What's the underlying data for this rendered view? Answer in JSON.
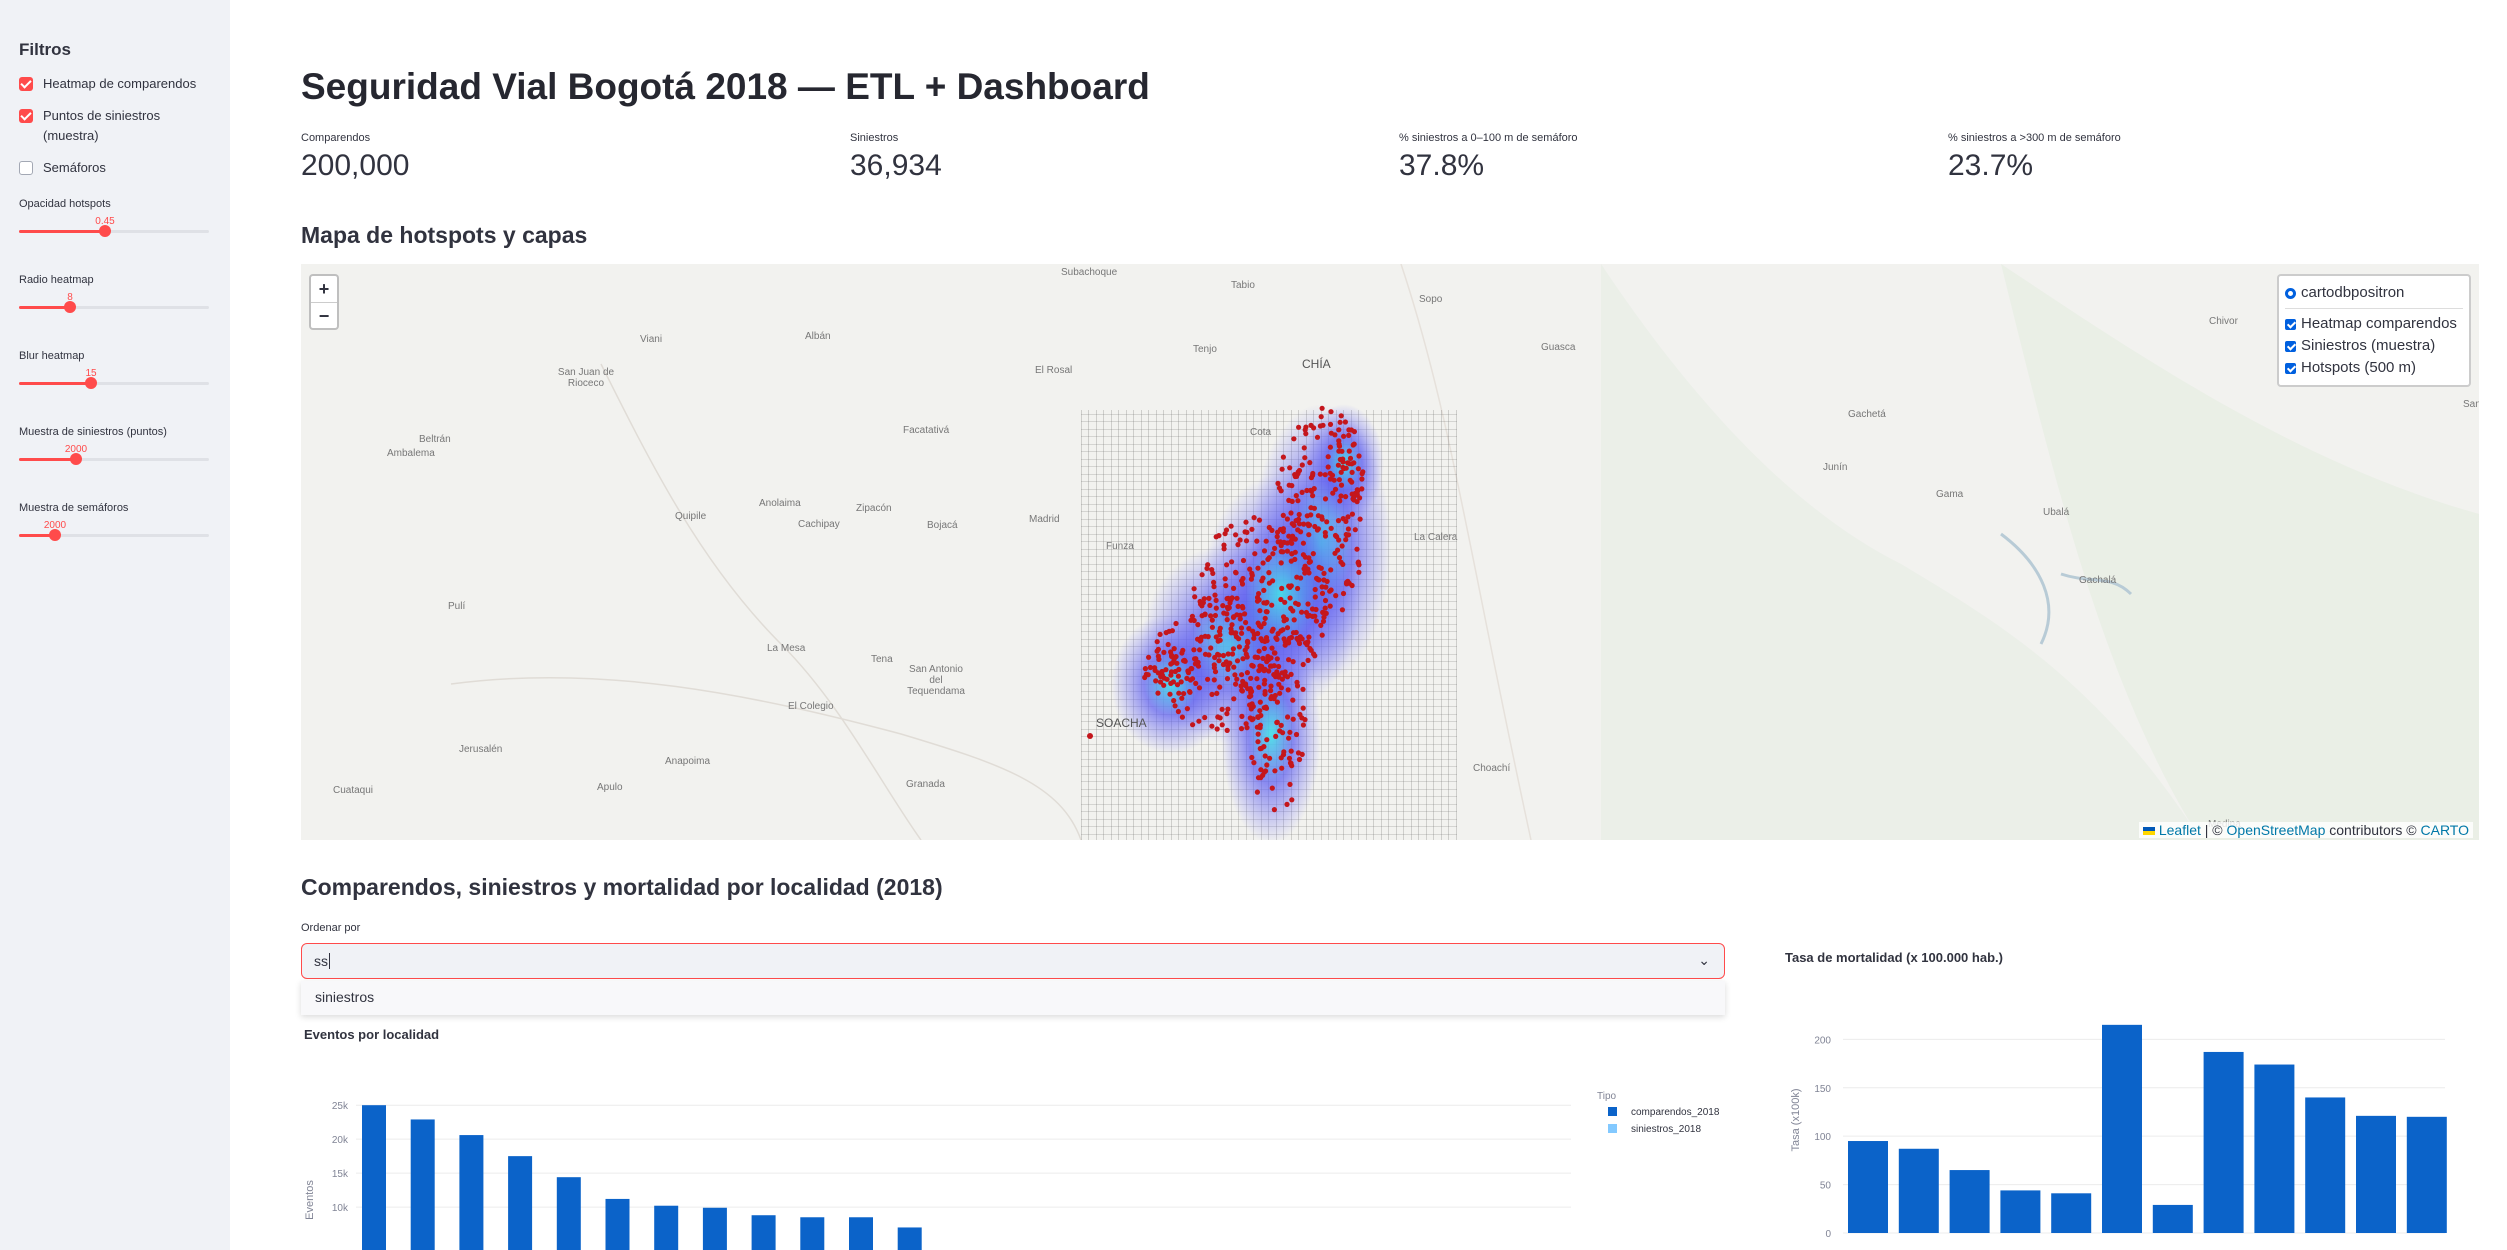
{
  "sidebar": {
    "title": "Filtros",
    "checkboxes": [
      {
        "label": "Heatmap de comparendos",
        "checked": true
      },
      {
        "label": "Puntos de siniestros (muestra)",
        "checked": true
      },
      {
        "label": "Semáforos",
        "checked": false
      }
    ],
    "sliders": [
      {
        "label": "Opacidad hotspots",
        "value": "0.45",
        "fraction": 0.45
      },
      {
        "label": "Radio heatmap",
        "value": "8",
        "fraction": 0.27
      },
      {
        "label": "Blur heatmap",
        "value": "15",
        "fraction": 0.38
      },
      {
        "label": "Muestra de siniestros (puntos)",
        "value": "2000",
        "fraction": 0.3
      },
      {
        "label": "Muestra de semáforos",
        "value": "2000",
        "fraction": 0.19
      }
    ]
  },
  "title": "Seguridad Vial Bogotá 2018 — ETL + Dashboard",
  "metrics": [
    {
      "label": "Comparendos",
      "value": "200,000"
    },
    {
      "label": "Siniestros",
      "value": "36,934"
    },
    {
      "label": "% siniestros a 0–100 m de semáforo",
      "value": "37.8%"
    },
    {
      "label": "% siniestros a >300 m de semáforo",
      "value": "23.7%"
    }
  ],
  "map_section": {
    "title": "Mapa de hotspots y capas",
    "zoom_in": "+",
    "zoom_out": "−",
    "base_layer": "cartodbpositron",
    "overlays": [
      "Heatmap comparendos",
      "Siniestros (muestra)",
      "Hotspots (500 m)"
    ],
    "attribution": {
      "leaflet": "Leaflet",
      "sep": "| ©",
      "osm": "OpenStreetMap",
      "contrib": "contributors ©",
      "carto": "CARTO"
    },
    "places": [
      "Subachoque",
      "Tabio",
      "Sopo",
      "Guasca",
      "Chivor",
      "Viani",
      "Albán",
      "Tenjo",
      "El Rosal",
      "CHÍA",
      "San Juan de Rioceco",
      "Beltrán",
      "Ambalema",
      "Facatativá",
      "Cachipay",
      "Anolaima",
      "Zipacón",
      "Bojacá",
      "Madrid",
      "Quipile",
      "Pulí",
      "La Mesa",
      "Tena",
      "San Antonio del Tequendama",
      "El Colegio",
      "Jerusalén",
      "Anapoima",
      "Apulo",
      "Granada",
      "Cuataqui",
      "SOACHA",
      "Choachí",
      "La Calera",
      "Funza",
      "Cota",
      "Gachetá",
      "Junín",
      "Gama",
      "Ubalá",
      "Gachalá",
      "Medina",
      "San"
    ]
  },
  "charts_section": {
    "title": "Comparendos, siniestros y mortalidad por localidad (2018)",
    "order_label": "Ordenar por",
    "order_input": "ss",
    "dropdown_option": "siniestros"
  },
  "chart_data": [
    {
      "type": "bar",
      "title": "Eventos por localidad",
      "ylabel": "Eventos",
      "legend_title": "Tipo",
      "yticks": [
        "10k",
        "15k",
        "20k",
        "25k"
      ],
      "series": [
        {
          "name": "comparendos_2018",
          "color": "#0b63c9",
          "values": [
            25000,
            22900,
            20600,
            17500,
            14400,
            11200,
            10200,
            9900,
            8800,
            8500,
            8500,
            7000
          ]
        },
        {
          "name": "siniestros_2018",
          "color": "#83c9ff",
          "values": []
        }
      ],
      "ylim": [
        0,
        26500
      ]
    },
    {
      "type": "bar",
      "title": "Tasa de mortalidad (x 100.000 hab.)",
      "ylabel": "Tasa (x100k)",
      "yticks": [
        "0",
        "50",
        "100",
        "150",
        "200"
      ],
      "values": [
        95,
        87,
        65,
        44,
        41,
        215,
        29,
        187,
        174,
        140,
        121,
        120
      ],
      "ylim": [
        0,
        220
      ]
    }
  ]
}
